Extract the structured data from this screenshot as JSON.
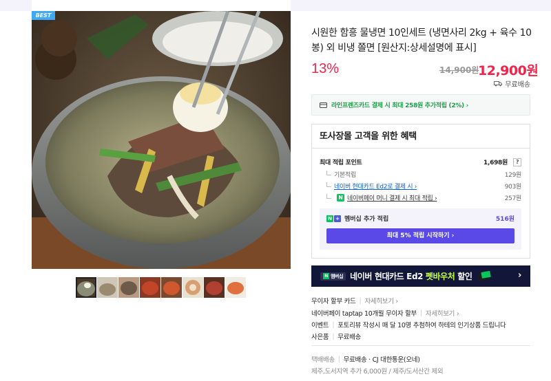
{
  "badge": "BEST",
  "product": {
    "title": "시원한 함흥 물냉면 10인세트 (냉면사리 2kg + 육수 10봉) 외 비냉 쫄면 [원산지:상세설명에 표시]",
    "discount": "13%",
    "original_price": "14,900원",
    "sale_price": "12,900원",
    "shipping": "무료배송"
  },
  "card_banner": "라인프렌즈카드 결제 시 최대 258원 추가적립 (2%) ›",
  "benefit": {
    "heading": "또사장몰 고객을 위한 혜택",
    "max_points_label": "최대 적립 포인트",
    "max_points_value": "1,698원",
    "help": "?",
    "rows": [
      {
        "label": "기본적립",
        "value": "129원"
      },
      {
        "label": "네이버 현대카드 Ed2로 결제 시 ›",
        "value": "903원"
      },
      {
        "label": "네이버페이 머니 결제 시 최대 적립 ›",
        "value": "257원"
      }
    ],
    "npay_badge": "N",
    "member_label": "멤버십 추가 적립",
    "member_value": "516원",
    "member_cta": "최대 5% 적립 시작하기 ›"
  },
  "promo": {
    "tag": "멤버십",
    "text_prefix": "네이버 현대카드 Ed2",
    "text_highlight": "펫바우처",
    "text_suffix": "할인",
    "chevron": "›"
  },
  "info": [
    {
      "label": "무이자 할부 카드",
      "link": "자세히보기 ›"
    },
    {
      "label": "네이버페이 taptap 10개월 무이자 할부",
      "link": "자세히보기 ›"
    },
    {
      "label": "이벤트",
      "link": "포토리뷰 작성시 매 달 10명 추첨하여 하테의 인기상품 드립니다"
    },
    {
      "label": "사은품",
      "link": "무료배송"
    }
  ],
  "delivery": {
    "label": "택배배송",
    "value": "무료배송 · CJ 대한통운(오네)",
    "extra": "제주,도서지역 추가 6,000원 / 제주/도서산간 제외"
  },
  "colors": {
    "price_red": "#f0234b",
    "naver_green": "#03c75a",
    "membership_purple": "#5a49e6",
    "promo_navy": "#12173a"
  }
}
